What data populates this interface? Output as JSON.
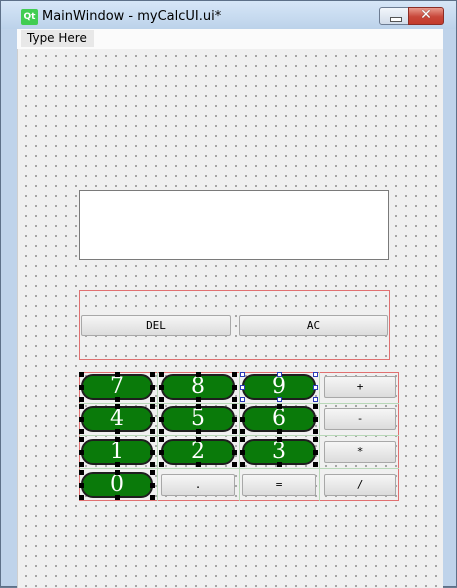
{
  "window": {
    "title": "MainWindow - myCalcUI.ui*",
    "logo_text": "Qt",
    "minimize_glyph": "",
    "close_glyph": "✕"
  },
  "menubar": {
    "type_here": "Type Here"
  },
  "display": {
    "value": ""
  },
  "function_buttons": {
    "del": "DEL",
    "ac": "AC"
  },
  "keypad": {
    "digits": {
      "d7": "7",
      "d8": "8",
      "d9": "9",
      "d4": "4",
      "d5": "5",
      "d6": "6",
      "d1": "1",
      "d2": "2",
      "d3": "3",
      "d0": "0"
    },
    "ops": {
      "plus": "+",
      "minus": "-",
      "multiply": "*",
      "divide": "/",
      "dot": ".",
      "equals": "="
    }
  },
  "colors": {
    "digit_button": "#0a7a0a",
    "layout_border": "#e07070",
    "titlebar": "#bfd3ea"
  }
}
